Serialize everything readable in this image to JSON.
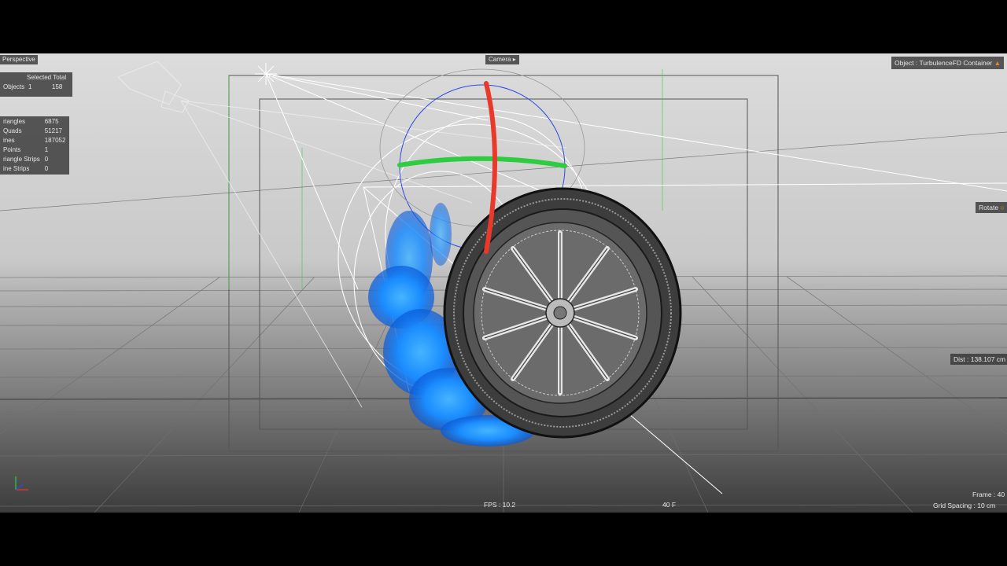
{
  "viewport": {
    "view_name": "Perspective",
    "camera_label": "Camera",
    "object_label": "Object : TurbulenceFD Container",
    "tool_label": "Rotate",
    "distance_label": "Dist : 138.107 cm",
    "fps_label": "FPS : 10.2",
    "frame_counter": "40 F",
    "frame_label": "Frame : 40",
    "grid_spacing_label": "Grid Spacing : 10 cm"
  },
  "stats_header": {
    "columns": "Selected Total",
    "row_label": "Objects",
    "selected": "1",
    "total": "158"
  },
  "poly_stats": [
    {
      "label": "riangles",
      "value": "6875"
    },
    {
      "label": "Quads",
      "value": "51217"
    },
    {
      "label": "ines",
      "value": "187052"
    },
    {
      "label": "Points",
      "value": "1"
    },
    {
      "label": "riangle Strips",
      "value": "0"
    },
    {
      "label": "ine Strips",
      "value": "0"
    }
  ],
  "colors": {
    "x_axis": "#e8392a",
    "y_axis": "#2ecc40",
    "z_axis": "#2a4be0",
    "smoke": "#1a8cff",
    "wireframe": "#ffffff",
    "hud_bg": "#373737"
  },
  "icons": [
    "camera-icon",
    "flame-icon",
    "rotate-icon",
    "axis-gizmo-icon"
  ]
}
